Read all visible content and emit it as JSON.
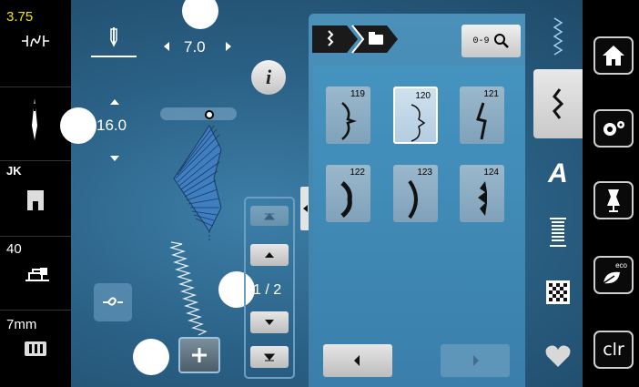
{
  "left_status": {
    "stitch_width": "3.75",
    "needle_label": "",
    "presser_foot": "JK",
    "tension": "40",
    "stitch_length": "7mm"
  },
  "stitch_controls": {
    "width_value": "7.0",
    "length_value": "16.0",
    "page_indicator": "1 / 2"
  },
  "breadcrumb": {
    "icons": [
      "zigzag-stitch-icon",
      "folder-icon"
    ]
  },
  "search_button": {
    "label": "0-9"
  },
  "patterns": [
    {
      "number": "119"
    },
    {
      "number": "120",
      "selected": true
    },
    {
      "number": "121"
    },
    {
      "number": "122"
    },
    {
      "number": "123"
    },
    {
      "number": "124"
    }
  ],
  "right_buttons": {
    "home": "home-icon",
    "settings": "gears-icon",
    "sewing": "dress-form-icon",
    "eco": "eco",
    "clear": "clr"
  },
  "tabs": [
    "practical-stitches-icon",
    "decorative-stitches-icon",
    "alphabet-icon",
    "buttonhole-icon",
    "quilt-icon",
    "favorites-icon"
  ],
  "colors": {
    "accent_yellow": "#f2e600",
    "background_blue": "#2b6186",
    "selected_tile": "#ffffff"
  }
}
